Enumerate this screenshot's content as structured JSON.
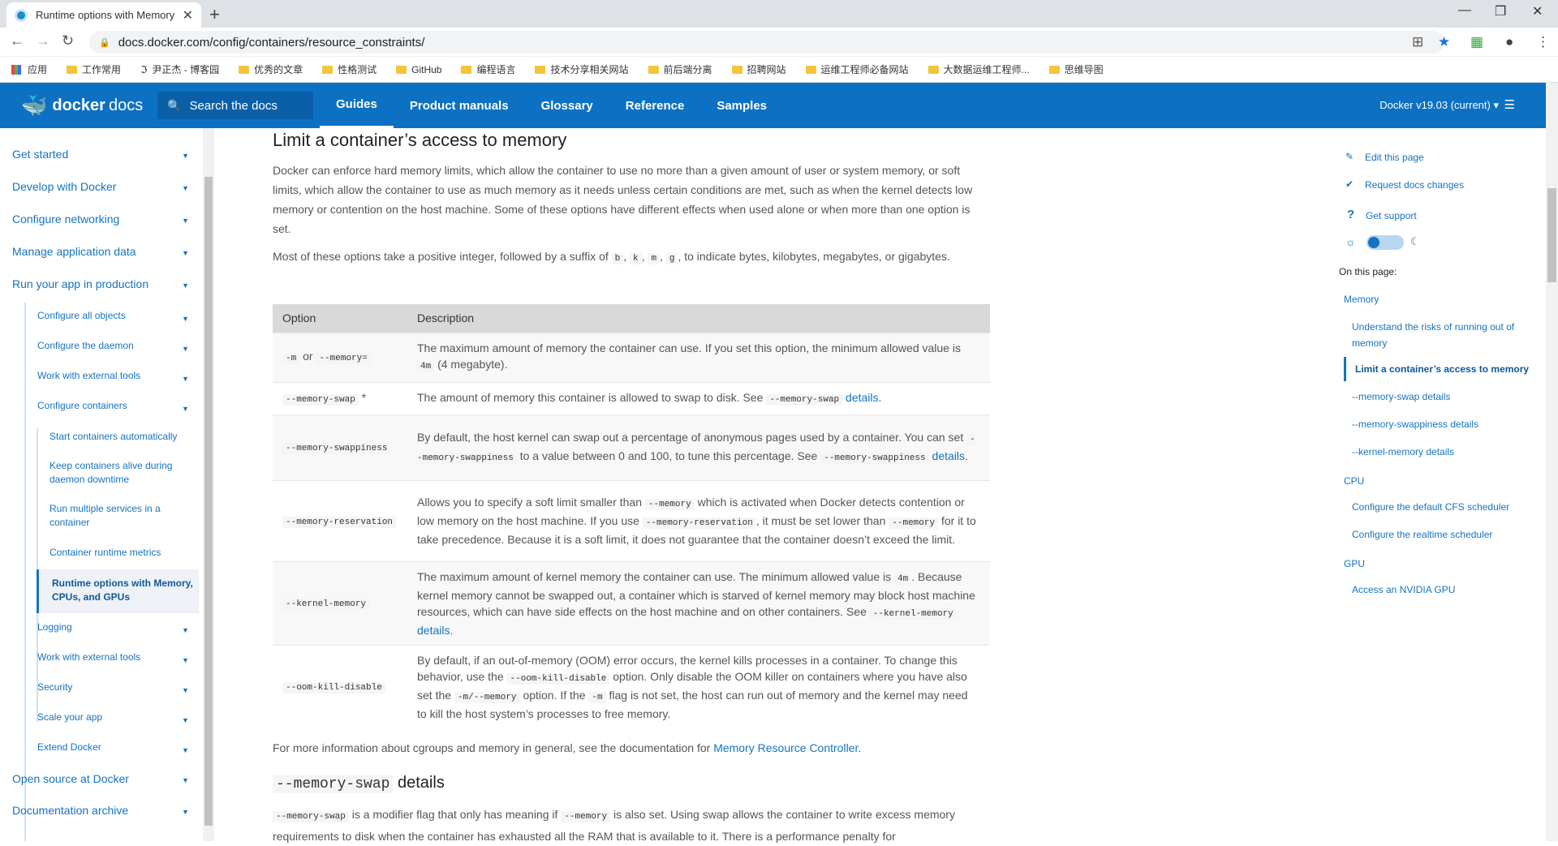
{
  "browser": {
    "tab_title": "Runtime options with Memory",
    "url": "docs.docker.com/config/containers/resource_constraints/",
    "bookmarks": [
      "应用",
      "工作常用",
      "尹正杰 - 博客园",
      "优秀的文章",
      "性格测试",
      "GitHub",
      "编程语言",
      "技术分享相关网站",
      "前后端分离",
      "招聘网站",
      "运维工程师必备网站",
      "大数据运维工程师...",
      "思维导图"
    ]
  },
  "header": {
    "logo_brand": "docker",
    "logo_docs": "docs",
    "search_placeholder": "Search the docs",
    "nav": [
      "Guides",
      "Product manuals",
      "Glossary",
      "Reference",
      "Samples"
    ],
    "version": "Docker v19.03 (current) ▾"
  },
  "sidebar": {
    "top_items": [
      "Get started",
      "Develop with Docker",
      "Configure networking",
      "Manage application data",
      "Run your app in production"
    ],
    "sub_items": [
      "Configure all objects",
      "Configure the daemon",
      "Work with external tools",
      "Configure containers"
    ],
    "sub_sub_items": [
      "Start containers automatically",
      "Keep containers alive during daemon downtime",
      "Run multiple services in a container",
      "Container runtime metrics",
      "Runtime options with Memory, CPUs, and GPUs"
    ],
    "sub_items_after": [
      "Logging",
      "Work with external tools",
      "Security",
      "Scale your app",
      "Extend Docker"
    ],
    "bottom_items": [
      "Open source at Docker",
      "Documentation archive"
    ]
  },
  "main": {
    "heading": "Limit a container’s access to memory",
    "intro": "Docker can enforce hard memory limits, which allow the container to use no more than a given amount of user or system memory, or soft limits, which allow the container to use as much memory as it needs unless certain conditions are met, such as when the kernel detects low memory or contention on the host machine. Some of these options have different effects when used alone or when more than one option is set.",
    "suffix_pre": "Most of these options take a positive integer, followed by a suffix of",
    "suffix_codes": [
      "b",
      "k",
      "m",
      "g"
    ],
    "suffix_post": ", to indicate bytes, kilobytes, megabytes, or gigabytes.",
    "table_headers": [
      "Option",
      "Description"
    ],
    "rows": [
      {
        "opt_a": "-m",
        "opt_or": "or",
        "opt_b": "--memory=",
        "d1": "The maximum amount of memory the container can use. If you set this option, the minimum allowed value is",
        "c1": "4m",
        "d2": "(4 megabyte)."
      },
      {
        "opt_a": "--memory-swap",
        "star": "*",
        "d1": "The amount of memory this container is allowed to swap to disk. See",
        "c1": "--memory-swap",
        "link": "details",
        "d2": "."
      },
      {
        "opt_a": "--memory-swappiness",
        "d1": "By default, the host kernel can swap out a percentage of anonymous pages used by a container. You can set",
        "c1": "--memory-swappiness",
        "d2": "to a value between 0 and 100, to tune this percentage. See",
        "c2": "--memory-swappiness",
        "link": "details",
        "d3": "."
      },
      {
        "opt_a": "--memory-reservation",
        "d1": "Allows you to specify a soft limit smaller than",
        "c1": "--memory",
        "d2": "which is activated when Docker detects contention or low memory on the host machine. If you use",
        "c2": "--memory-reservation",
        "d3": ", it must be set lower than",
        "c3": "--memory",
        "d4": "for it to take precedence. Because it is a soft limit, it does not guarantee that the container doesn’t exceed the limit."
      },
      {
        "opt_a": "--kernel-memory",
        "d1": "The maximum amount of kernel memory the container can use. The minimum allowed value is",
        "c1": "4m",
        "d2": ". Because kernel memory cannot be swapped out, a container which is starved of kernel memory may block host machine resources, which can have side effects on the host machine and on other containers. See",
        "c2": "--kernel-memory",
        "link": "details",
        "d3": "."
      },
      {
        "opt_a": "--oom-kill-disable",
        "d1": "By default, if an out-of-memory (OOM) error occurs, the kernel kills processes in a container. To change this behavior, use the",
        "c1": "--oom-kill-disable",
        "d2": "option. Only disable the OOM killer on containers where you have also set the",
        "c2": "-m/--memory",
        "d3": "option. If the",
        "c3": "-m",
        "d4": "flag is not set, the host can run out of memory and the kernel may need to kill the host system’s processes to free memory."
      }
    ],
    "more_info_pre": "For more information about cgroups and memory in general, see the documentation for",
    "more_info_link": "Memory Resource Controller",
    "more_info_post": ".",
    "swap_heading_code": "--memory-swap",
    "swap_heading_text": "details",
    "swap_code1": "--memory-swap",
    "swap_text1": "is a modifier flag that only has meaning if",
    "swap_code2": "--memory",
    "swap_text2": "is also set. Using swap allows the container to write excess memory requirements to disk when the container has exhausted all the RAM that is available to it. There is a performance penalty for"
  },
  "right": {
    "edit": "Edit this page",
    "request": "Request docs changes",
    "support": "Get support",
    "on_this_page": "On this page:",
    "toc": [
      "Memory",
      "Understand the risks of running out of memory",
      "Limit a container’s access to memory",
      "--memory-swap details",
      "--memory-swappiness details",
      "--kernel-memory details",
      "CPU",
      "Configure the default CFS scheduler",
      "Configure the realtime scheduler",
      "GPU",
      "Access an NVIDIA GPU"
    ]
  },
  "colors": {
    "brand": "#0c71c3",
    "link": "#1573c1"
  }
}
